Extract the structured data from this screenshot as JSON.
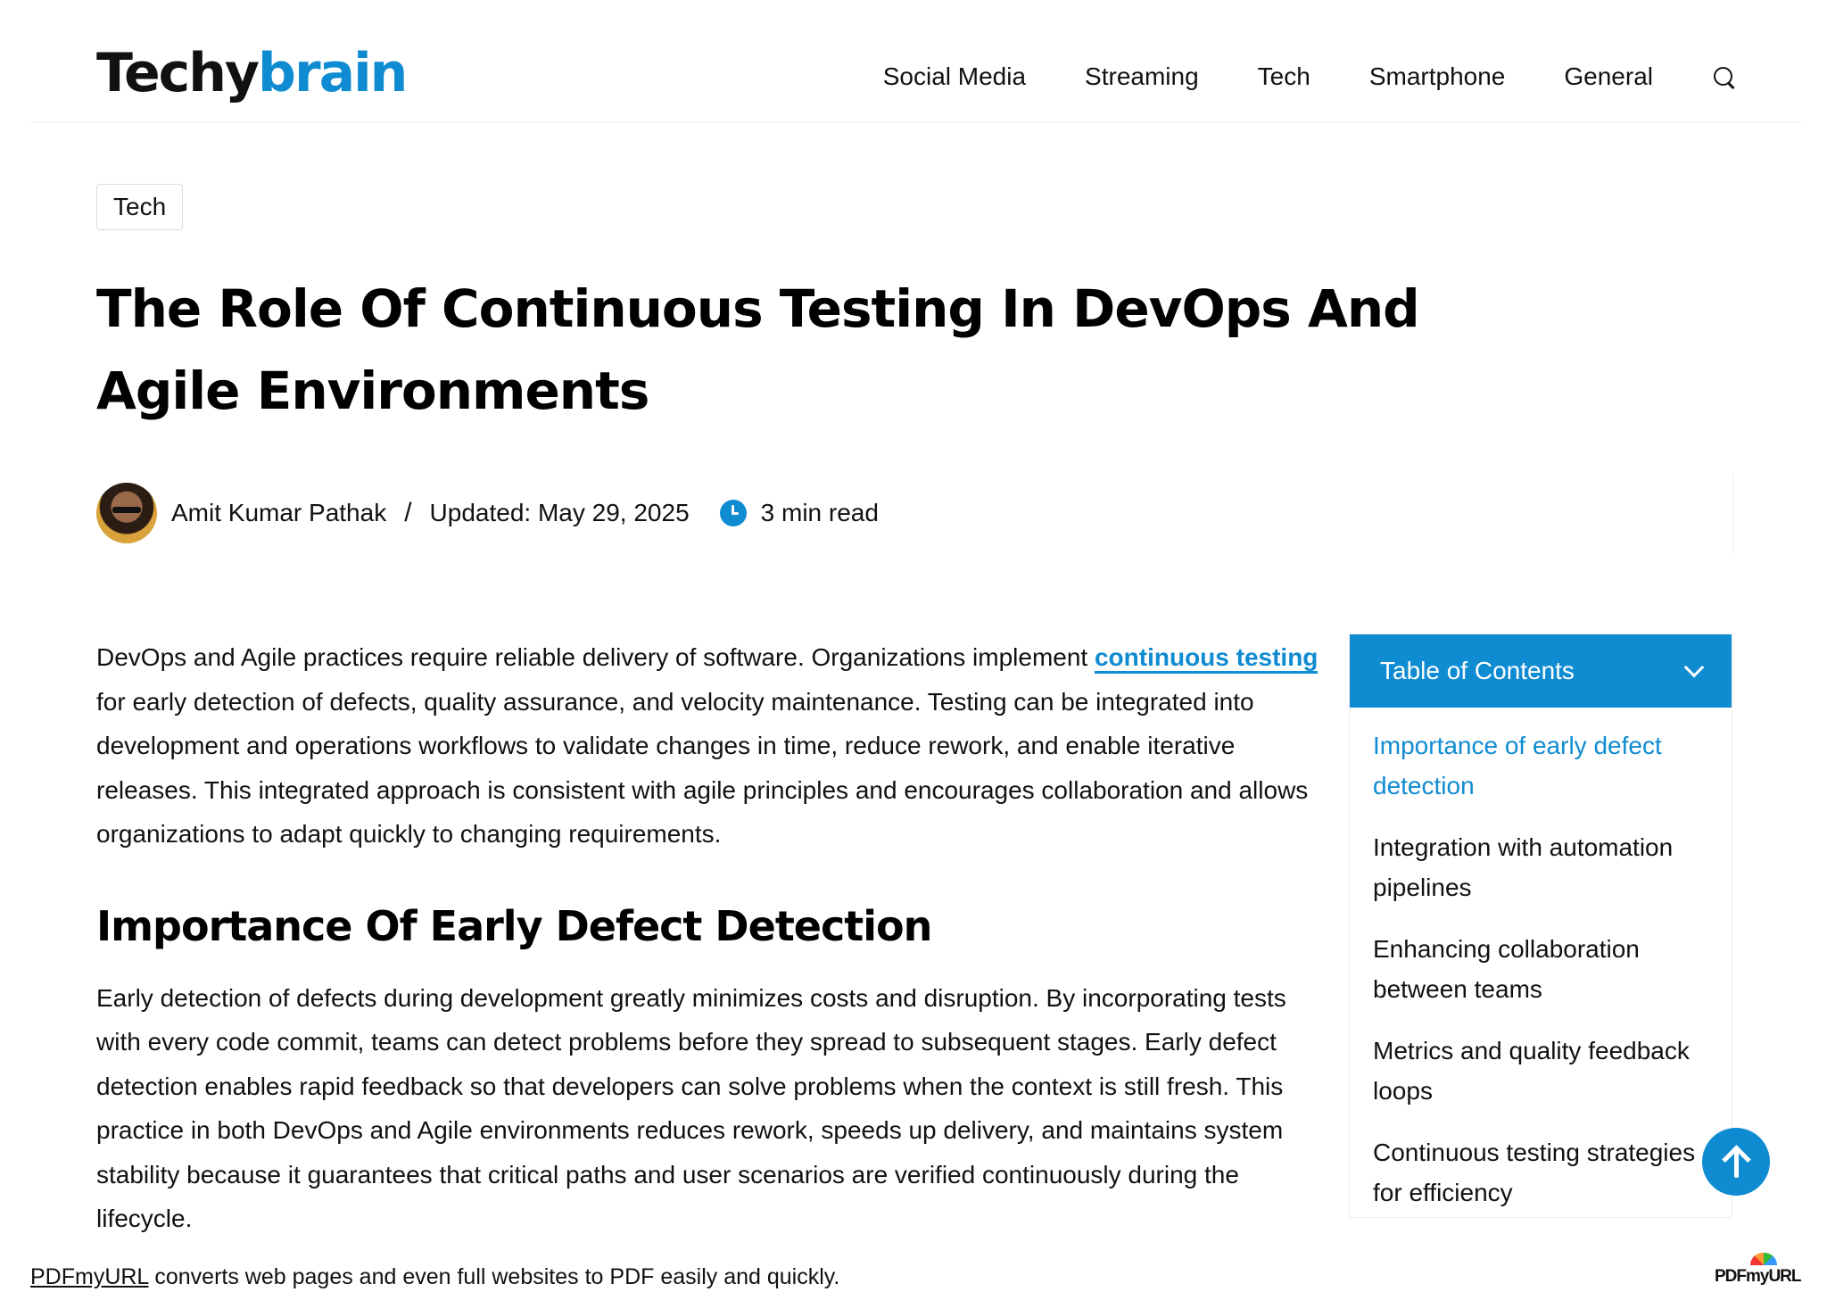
{
  "header": {
    "logo_part1": "Techy",
    "logo_part2": "brain",
    "nav": [
      "Social Media",
      "Streaming",
      "Tech",
      "Smartphone",
      "General"
    ],
    "search_icon": "search-icon"
  },
  "article": {
    "category": "Tech",
    "title": "The Role Of Continuous Testing In DevOps And Agile Environments",
    "author": "Amit Kumar Pathak",
    "separator": "/",
    "updated": "Updated: May 29, 2025",
    "read_time": "3 min read",
    "intro_before_link": "DevOps and Agile practices require reliable delivery of software. Organizations implement ",
    "intro_link": "continuous testing",
    "intro_after_link": " for early detection of defects, quality assurance, and velocity maintenance. Testing can be integrated into development and operations workflows to validate changes in time, reduce rework, and enable iterative releases. This integrated approach is consistent with agile principles and encourages collaboration and allows organizations to adapt quickly to changing requirements.",
    "section1_heading": "Importance Of Early Defect Detection",
    "section1_body": "Early detection of defects during development greatly minimizes costs and disruption. By incorporating tests with every code commit, teams can detect problems before they spread to subsequent stages. Early defect detection enables rapid feedback so that developers can solve problems when the context is still fresh. This practice in both DevOps and Agile environments reduces rework, speeds up delivery, and maintains system stability because it guarantees that critical paths and user scenarios are verified continuously during the lifecycle."
  },
  "toc": {
    "title": "Table of Contents",
    "items": [
      "Importance of early defect detection",
      "Integration with automation pipelines",
      "Enhancing collaboration between teams",
      "Metrics and quality feedback loops",
      "Continuous testing strategies for efficiency"
    ]
  },
  "footer": {
    "link": "PDFmyURL",
    "text": " converts web pages and even full websites to PDF easily and quickly.",
    "badge": "PDFmyURL"
  },
  "colors": {
    "accent": "#0f8bd2",
    "text": "#111111"
  }
}
